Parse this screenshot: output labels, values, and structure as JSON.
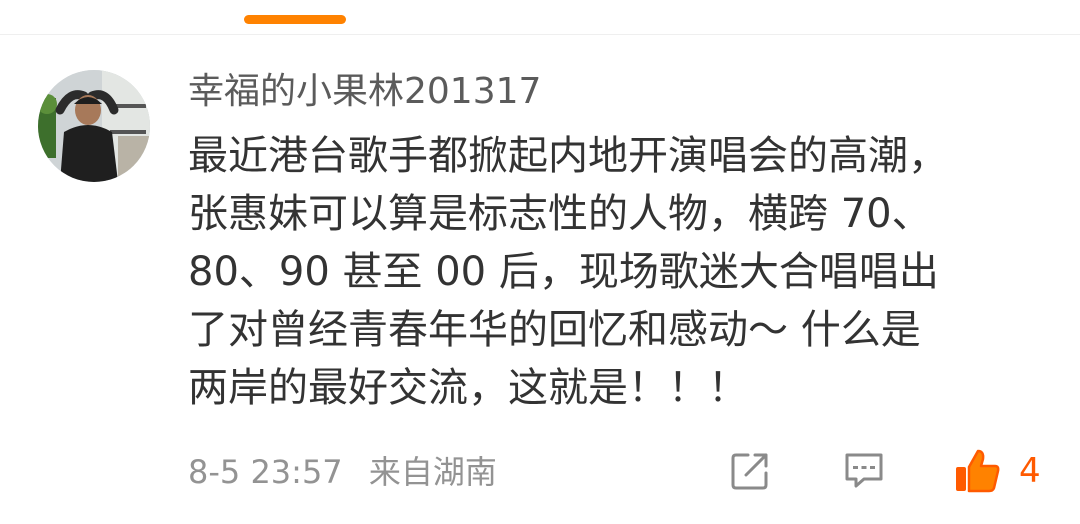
{
  "comment": {
    "username": "幸福的小果林201317",
    "text_lines": [
      "最近港台歌手都掀起内地开演唱会的高潮，",
      "张惠妹可以算是标志性的人物，横跨 70、",
      "80、90 甚至 00 后，现场歌迷大合唱唱出",
      "了对曾经青春年华的回忆和感动～  什么是",
      "两岸的最好交流，这就是！！！"
    ],
    "date": "8-5 23:57",
    "source": "来自湖南",
    "like_count": "4"
  },
  "colors": {
    "accent": "#ff8200",
    "like": "#ff5a00",
    "username": "#5b5b5b",
    "text": "#333333",
    "meta": "#939393"
  },
  "icons": {
    "share": "share-icon",
    "reply": "reply-icon",
    "like": "thumbs-up-icon"
  }
}
